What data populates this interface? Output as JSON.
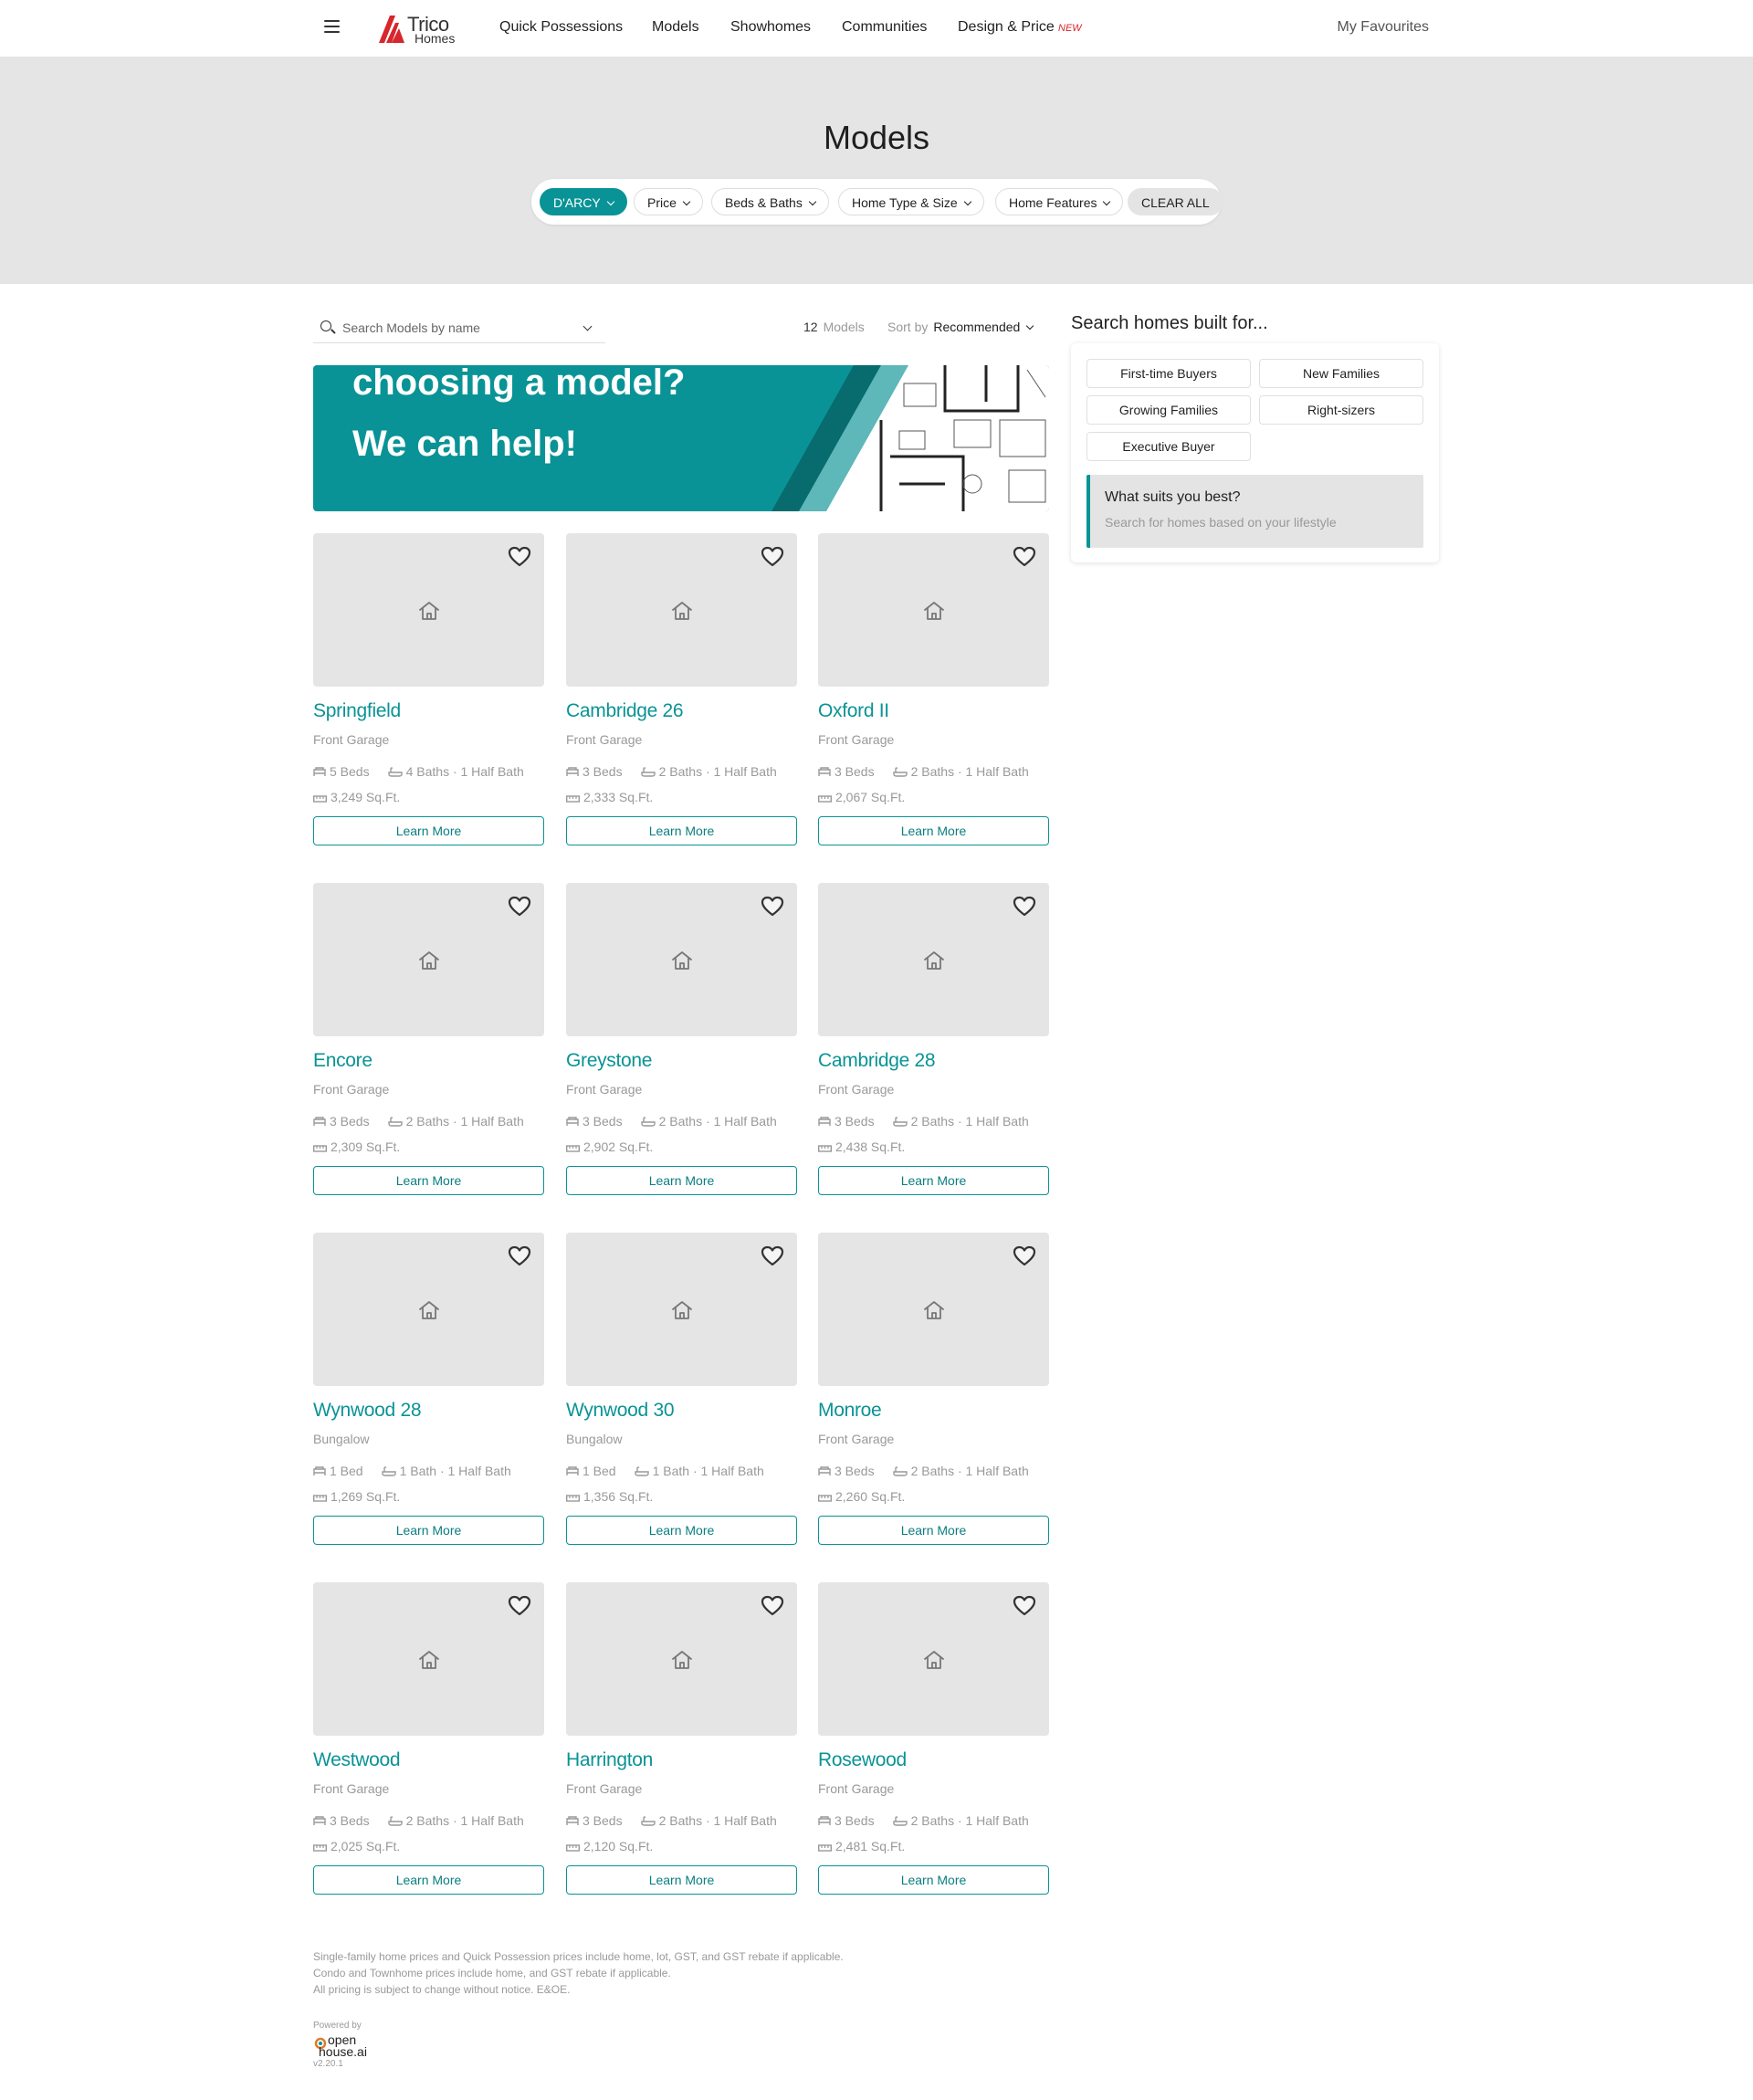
{
  "header": {
    "logo_line1": "Trico",
    "logo_line2": "Homes",
    "nav": [
      "Quick Possessions",
      "Models",
      "Showhomes",
      "Communities",
      "Design & Price"
    ],
    "new_badge": "NEW",
    "favourites": "My Favourites"
  },
  "hero": {
    "title": "Models",
    "filters": [
      "D'ARCY",
      "Price",
      "Beds & Baths",
      "Home Type & Size",
      "Home Features"
    ],
    "clear_all": "CLEAR ALL"
  },
  "toolbar": {
    "search_placeholder": "Search Models by name",
    "count": "12",
    "count_label": "Models",
    "sort_label": "Sort by",
    "sort_value": "Recommended"
  },
  "banner": {
    "line1": "choosing a model?",
    "line2": "We can help!"
  },
  "models": [
    {
      "name": "Springfield",
      "type": "Front Garage",
      "beds": "5 Beds",
      "baths": "4 Baths · 1 Half Bath",
      "sqft": "3,249 Sq.Ft.",
      "cta": "Learn More"
    },
    {
      "name": "Cambridge 26",
      "type": "Front Garage",
      "beds": "3 Beds",
      "baths": "2 Baths · 1 Half Bath",
      "sqft": "2,333 Sq.Ft.",
      "cta": "Learn More"
    },
    {
      "name": "Oxford II",
      "type": "Front Garage",
      "beds": "3 Beds",
      "baths": "2 Baths · 1 Half Bath",
      "sqft": "2,067 Sq.Ft.",
      "cta": "Learn More"
    },
    {
      "name": "Encore",
      "type": "Front Garage",
      "beds": "3 Beds",
      "baths": "2 Baths · 1 Half Bath",
      "sqft": "2,309 Sq.Ft.",
      "cta": "Learn More"
    },
    {
      "name": "Greystone",
      "type": "Front Garage",
      "beds": "3 Beds",
      "baths": "2 Baths · 1 Half Bath",
      "sqft": "2,902 Sq.Ft.",
      "cta": "Learn More"
    },
    {
      "name": "Cambridge 28",
      "type": "Front Garage",
      "beds": "3 Beds",
      "baths": "2 Baths · 1 Half Bath",
      "sqft": "2,438 Sq.Ft.",
      "cta": "Learn More"
    },
    {
      "name": "Wynwood 28",
      "type": "Bungalow",
      "beds": "1 Bed",
      "baths": "1 Bath · 1 Half Bath",
      "sqft": "1,269 Sq.Ft.",
      "cta": "Learn More"
    },
    {
      "name": "Wynwood 30",
      "type": "Bungalow",
      "beds": "1 Bed",
      "baths": "1 Bath · 1 Half Bath",
      "sqft": "1,356 Sq.Ft.",
      "cta": "Learn More"
    },
    {
      "name": "Monroe",
      "type": "Front Garage",
      "beds": "3 Beds",
      "baths": "2 Baths · 1 Half Bath",
      "sqft": "2,260 Sq.Ft.",
      "cta": "Learn More"
    },
    {
      "name": "Westwood",
      "type": "Front Garage",
      "beds": "3 Beds",
      "baths": "2 Baths · 1 Half Bath",
      "sqft": "2,025 Sq.Ft.",
      "cta": "Learn More"
    },
    {
      "name": "Harrington",
      "type": "Front Garage",
      "beds": "3 Beds",
      "baths": "2 Baths · 1 Half Bath",
      "sqft": "2,120 Sq.Ft.",
      "cta": "Learn More"
    },
    {
      "name": "Rosewood",
      "type": "Front Garage",
      "beds": "3 Beds",
      "baths": "2 Baths · 1 Half Bath",
      "sqft": "2,481 Sq.Ft.",
      "cta": "Learn More"
    }
  ],
  "sidebar": {
    "title": "Search homes built for...",
    "chips": [
      "First-time Buyers",
      "New Families",
      "Growing Families",
      "Right-sizers",
      "Executive Buyer"
    ],
    "suits_title": "What suits you best?",
    "suits_sub": "Search for homes based on your lifestyle"
  },
  "footer": {
    "disclaimer": [
      "Single-family home prices and Quick Possession prices include home, lot, GST, and GST rebate if applicable.",
      "Condo and Townhome prices include home, and GST rebate if applicable.",
      "All pricing is subject to change without notice. E&OE."
    ],
    "powered_by": "Powered by",
    "brand_line1": "open",
    "brand_line2": "house.ai",
    "version": "v2.20.1"
  },
  "colors": {
    "accent": "#0a9396",
    "brand_red": "#d7262c",
    "hero_bg": "#e5e5e5"
  }
}
